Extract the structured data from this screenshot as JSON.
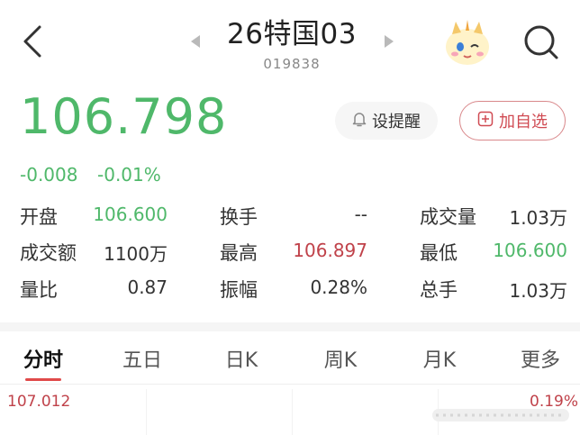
{
  "header": {
    "title": "26特国03",
    "code": "019838"
  },
  "quote": {
    "price": "106.798",
    "change": "-0.008",
    "change_pct": "-0.01%"
  },
  "actions": {
    "alert_label": "设提醒",
    "favorite_label": "加自选"
  },
  "stats": [
    [
      {
        "label": "开盘",
        "value": "106.600",
        "tone": "green"
      },
      {
        "label": "换手",
        "value": "--",
        "tone": "neutral"
      },
      {
        "label": "成交量",
        "value": "1.03万",
        "tone": "neutral"
      }
    ],
    [
      {
        "label": "成交额",
        "value": "1100万",
        "tone": "neutral"
      },
      {
        "label": "最高",
        "value": "106.897",
        "tone": "red"
      },
      {
        "label": "最低",
        "value": "106.600",
        "tone": "green"
      }
    ],
    [
      {
        "label": "量比",
        "value": "0.87",
        "tone": "neutral"
      },
      {
        "label": "振幅",
        "value": "0.28%",
        "tone": "neutral"
      },
      {
        "label": "总手",
        "value": "1.03万",
        "tone": "neutral"
      }
    ]
  ],
  "tabs": [
    {
      "label": "分时",
      "active": true
    },
    {
      "label": "五日",
      "active": false
    },
    {
      "label": "日K",
      "active": false
    },
    {
      "label": "周K",
      "active": false
    },
    {
      "label": "月K",
      "active": false
    },
    {
      "label": "更多",
      "active": false
    }
  ],
  "chart": {
    "max_price": "107.012",
    "max_pct": "0.19%"
  },
  "colors": {
    "up": "#c0424a",
    "down": "#4fb86a",
    "accent": "#e04a4a"
  },
  "icons": [
    "back-arrow-icon",
    "prev-stock-icon",
    "next-stock-icon",
    "mascot-icon",
    "search-icon",
    "bell-icon",
    "plus-square-icon"
  ]
}
